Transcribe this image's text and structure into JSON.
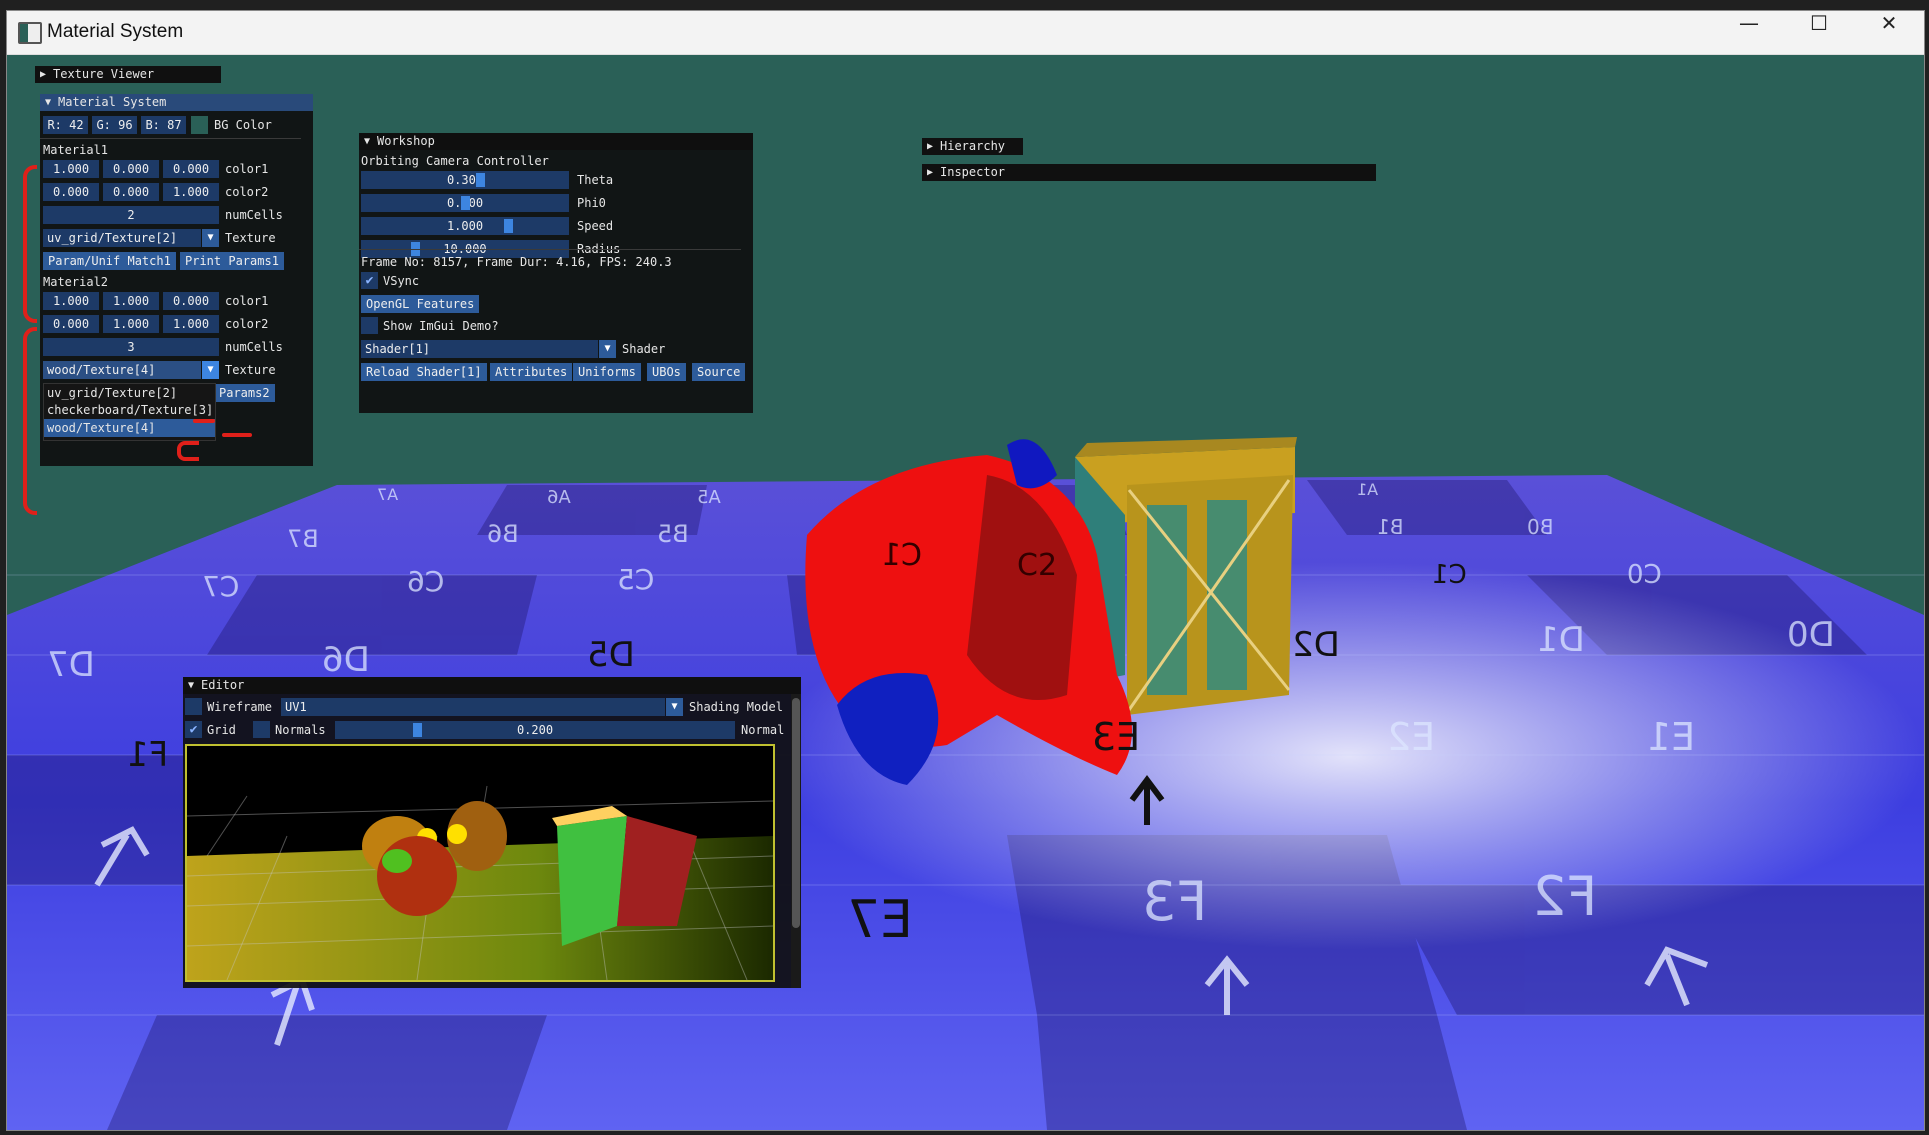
{
  "window": {
    "title": "Material System",
    "minimize_icon": "minimize-icon",
    "maximize_icon": "maximize-icon",
    "close_icon": "close-icon"
  },
  "texture_viewer": {
    "title": "Texture Viewer"
  },
  "material_system": {
    "title": "Material System",
    "bg": {
      "r": "R: 42",
      "g": "G: 96",
      "b": "B: 87",
      "label": "BG Color",
      "color": "#2a6057"
    },
    "material1": {
      "name": "Material1",
      "color1": [
        "1.000",
        "0.000",
        "0.000"
      ],
      "color1_label": "color1",
      "color2": [
        "0.000",
        "0.000",
        "1.000"
      ],
      "color2_label": "color2",
      "numcells": "2",
      "numcells_label": "numCells",
      "texture": "uv_grid/Texture[2]",
      "texture_label": "Texture",
      "btn_match": "Param/Unif Match1",
      "btn_print": "Print Params1"
    },
    "material2": {
      "name": "Material2",
      "color1": [
        "1.000",
        "1.000",
        "0.000"
      ],
      "color1_label": "color1",
      "color2": [
        "0.000",
        "1.000",
        "1.000"
      ],
      "color2_label": "color2",
      "numcells": "3",
      "numcells_label": "numCells",
      "texture": "wood/Texture[4]",
      "texture_label": "Texture",
      "btn_params": "Params2",
      "dropdown_options": [
        "uv_grid/Texture[2]",
        "checkerboard/Texture[3]",
        "wood/Texture[4]"
      ]
    }
  },
  "workshop": {
    "title": "Workshop",
    "camera_label": "Orbiting Camera Controller",
    "sliders": [
      {
        "value": "0.300",
        "label": "Theta",
        "level": 0.58
      },
      {
        "value": "0.000",
        "label": "Phi0",
        "level": 0.5
      },
      {
        "value": "1.000",
        "label": "Speed",
        "level": 0.72
      },
      {
        "value": "10.000",
        "label": "Radius",
        "level": 0.25
      }
    ],
    "frame_info": "Frame No:   8157, Frame Dur: 4.16, FPS: 240.3",
    "vsync": "VSync",
    "opengl_btn": "OpenGL Features",
    "imgui_demo": "Show ImGui Demo?",
    "shader_value": "Shader[1]",
    "shader_label": "Shader",
    "buttons": [
      "Reload Shader[1]",
      "Attributes",
      "Uniforms",
      "UBOs",
      "Source"
    ]
  },
  "hierarchy": {
    "title": "Hierarchy"
  },
  "inspector": {
    "title": "Inspector"
  },
  "editor": {
    "title": "Editor",
    "wireframe": "Wireframe",
    "uv_value": "UV1",
    "shading_label": "Shading Model",
    "grid": "Grid",
    "normals": "Normals",
    "slider_value": "0.200",
    "slider_level": 0.2,
    "normal_label": "Normal"
  },
  "floor_labels": [
    "A7",
    "A6",
    "A5",
    "B7",
    "B6",
    "B5",
    "C7",
    "C6",
    "C5",
    "D7",
    "D6",
    "D5",
    "E3",
    "F3",
    "F2",
    "E2",
    "E1",
    "D2",
    "D1",
    "D0",
    "C1",
    "C0",
    "B1",
    "B0",
    "A1",
    "E7",
    "F1"
  ],
  "mesh_labels": [
    "C1",
    "C2"
  ]
}
